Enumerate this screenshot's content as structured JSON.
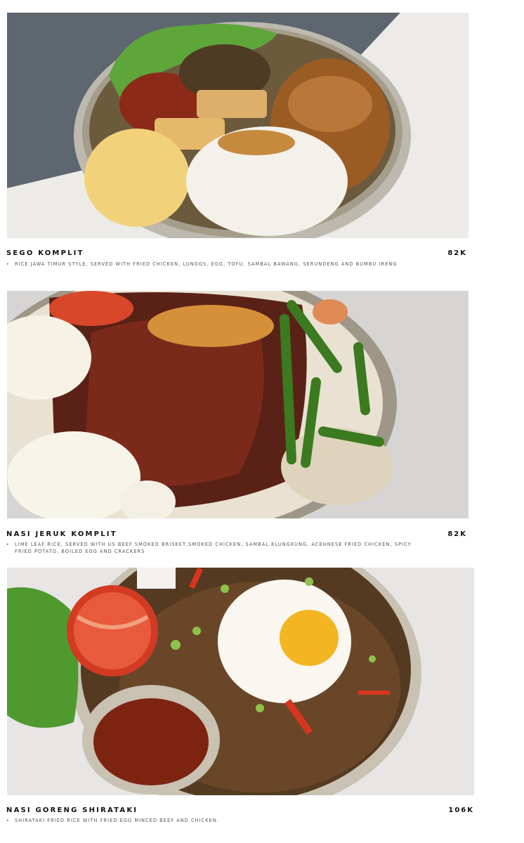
{
  "menu": {
    "items": [
      {
        "name": "SEGO KOMPLIT",
        "price": "82K",
        "bullet": "•",
        "description": "RICE JAWA TIMUR STYLE, SERVED  WITH FRIED CHICKEN, LUNGGS, EGG, TOFU, SAMBAL BAWANG, SERUNDENG AND BUMBU IRENG",
        "photo_icon": "nasi-campur-bowl"
      },
      {
        "name": "NASI JERUK KOMPLIT",
        "price": "82K",
        "bullet": "•",
        "description": "LIME LEAF RICE, SERVED WITH US BEEF SMOKED BRISKET,SMOKED CHICKEN, SAMBAL KLUNGKUNG, ACEHNESE FRIED CHICKEN, SPICY FRIED POTATO, BOILED EGG AND CRACKERS",
        "photo_icon": "nasi-jeruk-bowl"
      },
      {
        "name": "NASI GORENG SHIRATAKI",
        "price": "106K",
        "bullet": "•",
        "description": "SHIRATAKI FRIED RICE WITH FRIED EGG MINCED BEEF AND CHICKEN.",
        "photo_icon": "fried-rice-bowl"
      }
    ]
  },
  "colors": {
    "background": "#ffffff",
    "title_text": "#111111",
    "description_text": "#555555"
  }
}
